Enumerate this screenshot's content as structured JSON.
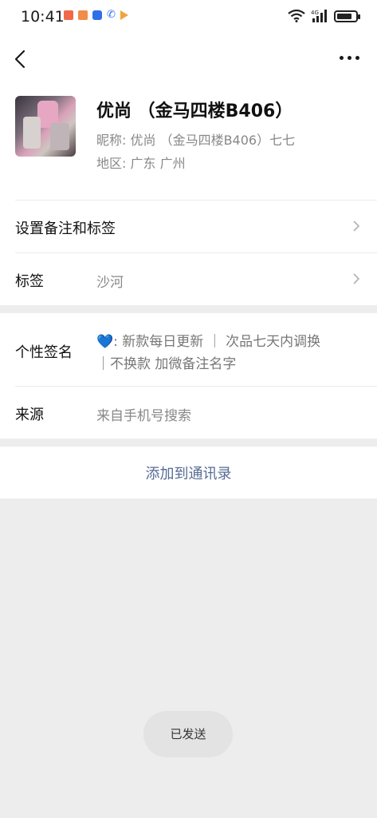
{
  "status_bar": {
    "time": "10:41",
    "notification_icons": [
      "app-red-icon",
      "app-orange-icon",
      "app-blue-icon",
      "phone-icon",
      "play-icon"
    ],
    "network_label": "4G"
  },
  "nav": {
    "back_icon": "chevron-left-icon",
    "more_icon": "more-dots-icon"
  },
  "profile": {
    "name": "优尚 （金马四楼B406）",
    "nickname": "昵称:  优尚 （金马四楼B406）七七",
    "region": "地区:  广东  广州"
  },
  "rows": {
    "remark": {
      "label": "设置备注和标签"
    },
    "tags": {
      "label": "标签",
      "value": "沙河"
    },
    "signature": {
      "label": "个性签名",
      "line1": "💙:  新款每日更新 ｜ 次品七天内调换",
      "line2": "｜不换款 加微备注名字"
    },
    "source": {
      "label": "来源",
      "value": "来自手机号搜索"
    }
  },
  "actions": {
    "add_contact": "添加到通讯录"
  },
  "toast": {
    "text": "已发送"
  },
  "colors": {
    "link": "#576b95",
    "background": "#ededed",
    "secondary_text": "#888888"
  }
}
